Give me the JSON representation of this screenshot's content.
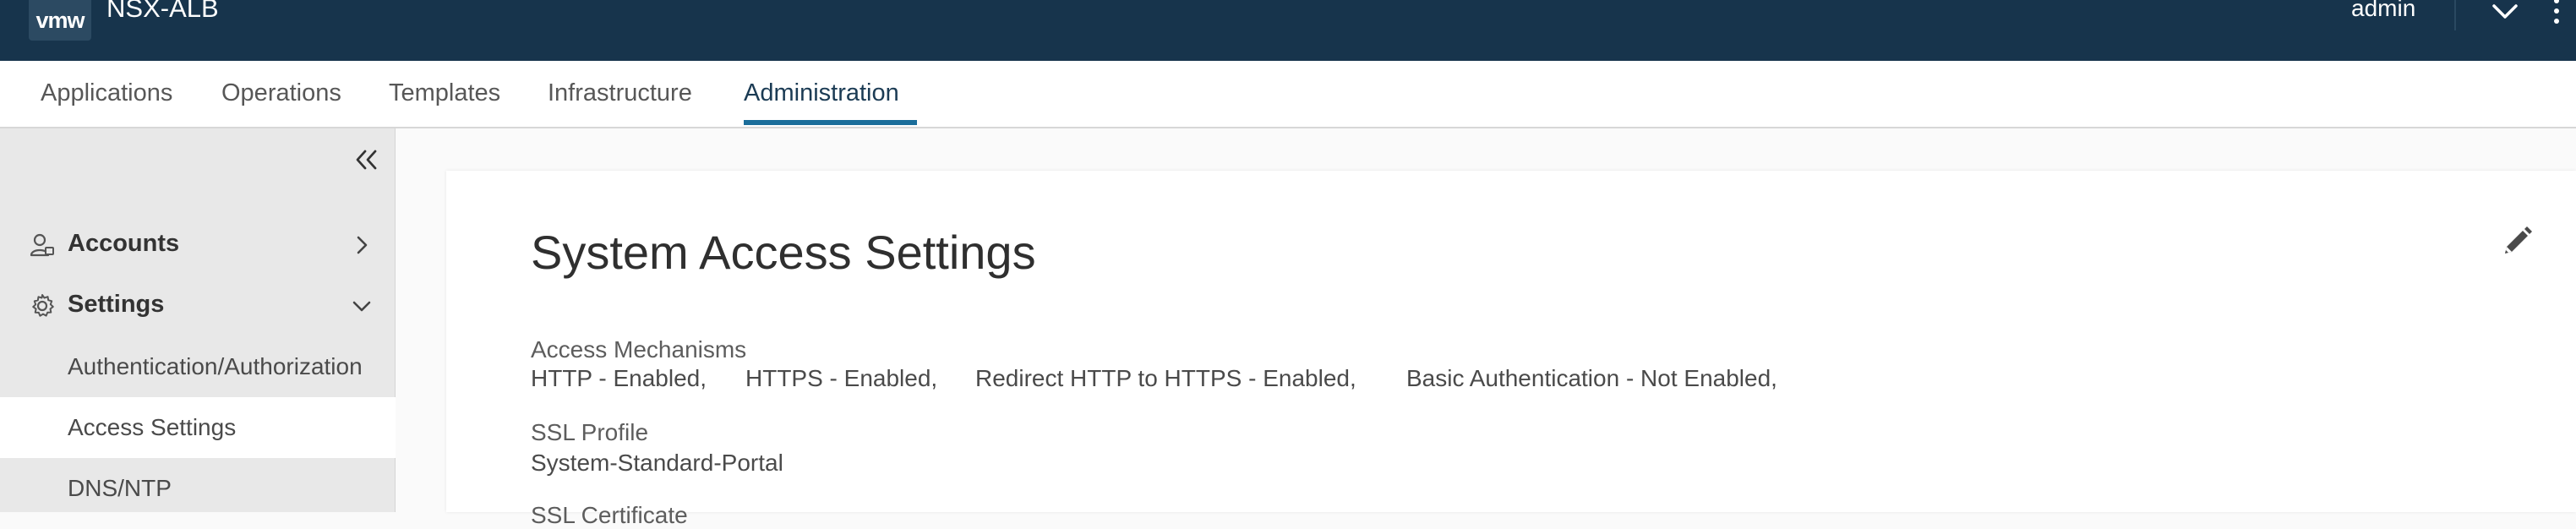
{
  "header": {
    "logo_text": "vmw",
    "app_title": "NSX-ALB",
    "user": "admin",
    "user_menu_icon": "chevron-down-icon",
    "more_icon": "kebab-icon",
    "background_color": "#17344c"
  },
  "nav": {
    "tabs": [
      {
        "label": "Applications"
      },
      {
        "label": "Operations"
      },
      {
        "label": "Templates"
      },
      {
        "label": "Infrastructure"
      },
      {
        "label": "Administration"
      }
    ],
    "active": "Administration",
    "accent_color": "#1b6e9b"
  },
  "sidebar": {
    "collapse_icon": "double-chevron-left-icon",
    "items": [
      {
        "label": "Accounts",
        "icon": "user-icon",
        "chevron": "chevron-right-icon"
      },
      {
        "label": "Settings",
        "icon": "gear-icon",
        "chevron": "chevron-down-icon"
      }
    ],
    "sub_items": [
      {
        "label": "Authentication/Authorization"
      },
      {
        "label": "Access Settings"
      },
      {
        "label": "DNS/NTP"
      }
    ],
    "active_sub": "Access Settings"
  },
  "main": {
    "title": "System Access Settings",
    "edit_icon": "pencil-icon",
    "access_mechanisms": {
      "label": "Access Mechanisms",
      "values": [
        "HTTP - Enabled,",
        "HTTPS - Enabled,",
        "Redirect HTTP to HTTPS - Enabled,",
        "Basic Authentication - Not Enabled,"
      ]
    },
    "ssl_profile": {
      "label": "SSL Profile",
      "value": "System-Standard-Portal"
    },
    "ssl_certificate": {
      "label": "SSL Certificate"
    }
  }
}
